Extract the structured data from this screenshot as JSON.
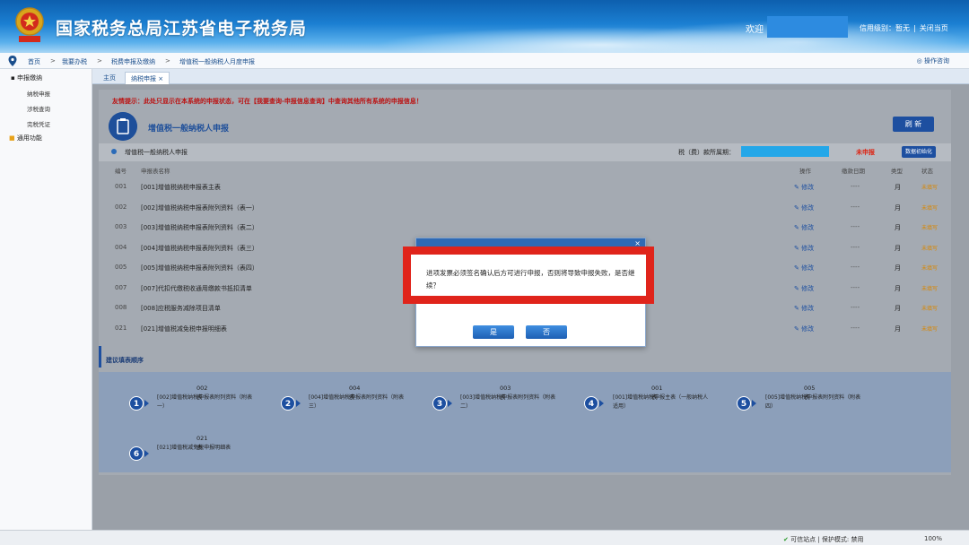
{
  "header": {
    "site_title": "国家税务总局江苏省电子税务局",
    "welcome": "欢迎",
    "credit_level": "信用级别：暂无",
    "close_page": "关闭当页"
  },
  "breadcrumb": {
    "items": [
      "首页",
      "我要办税",
      "税费申报及缴纳",
      "增值税一般纳税人月度申报"
    ],
    "separator": ">",
    "help": "操作咨询"
  },
  "sidebar": {
    "section": "申报缴纳",
    "items": [
      "纳税申报",
      "涉税查询",
      "完税凭证"
    ],
    "common": "通用功能"
  },
  "tabs": [
    "主页",
    "纳税申报"
  ],
  "notice": "友情提示：此处只显示在本系统的申报状态，可在【我要查询-申报信息查询】中查询其他所有系统的申报信息！",
  "form": {
    "title": "增值税一般纳税人申报",
    "refresh": "刷 新",
    "section_label": "增值税一般纳税人申报",
    "period_label": "税（费）款所属期：",
    "unfiled": "未申报",
    "init_button": "数据初始化"
  },
  "table": {
    "headers": [
      "编号",
      "申报表名称",
      "操作",
      "缴款日期",
      "类型",
      "状态"
    ],
    "rows": [
      {
        "code": "001",
        "name": "[001]增值税纳税申报表主表",
        "action": "修改",
        "deadline": "----",
        "type": "月",
        "status": "未填写"
      },
      {
        "code": "002",
        "name": "[002]增值税纳税申报表附列资料（表一）",
        "action": "修改",
        "deadline": "----",
        "type": "月",
        "status": "未填写"
      },
      {
        "code": "003",
        "name": "[003]增值税纳税申报表附列资料（表二）",
        "action": "修改",
        "deadline": "----",
        "type": "月",
        "status": "未填写"
      },
      {
        "code": "004",
        "name": "[004]增值税纳税申报表附列资料（表三）",
        "action": "修改",
        "deadline": "----",
        "type": "月",
        "status": "未填写"
      },
      {
        "code": "005",
        "name": "[005]增值税纳税申报表附列资料（表四）",
        "action": "修改",
        "deadline": "----",
        "type": "月",
        "status": "未填写"
      },
      {
        "code": "007",
        "name": "[007]代扣代缴税收通用缴款书抵扣清单",
        "action": "修改",
        "deadline": "----",
        "type": "月",
        "status": "未填写"
      },
      {
        "code": "008",
        "name": "[008]应税服务减除项目清单",
        "action": "修改",
        "deadline": "----",
        "type": "月",
        "status": "未填写"
      },
      {
        "code": "021",
        "name": "[021]增值税减免税申报明细表",
        "action": "修改",
        "deadline": "----",
        "type": "月",
        "status": "未填写"
      }
    ]
  },
  "suggest": {
    "label": "建议填表顺序",
    "steps": [
      {
        "num": "1",
        "code": "002表",
        "desc": "[002]增值税纳税申报表附列资料（附表一）"
      },
      {
        "num": "2",
        "code": "004表",
        "desc": "[004]增值税纳税申报表附列资料（附表三）"
      },
      {
        "num": "3",
        "code": "003表",
        "desc": "[003]增值税纳税申报表附列资料（附表二）"
      },
      {
        "num": "4",
        "code": "001表",
        "desc": "[001]增值税纳税申报主表（一般纳税人适用）"
      },
      {
        "num": "5",
        "code": "005表",
        "desc": "[005]增值税纳税申报表附列资料（附表四）"
      },
      {
        "num": "6",
        "code": "021表",
        "desc": "[021]增值税减免税申报明细表"
      }
    ]
  },
  "modal": {
    "message": "进项发票必须签名确认后方可进行申报，否则将导致申报失败，是否继续？",
    "yes": "是",
    "no": "否",
    "close": "×"
  },
  "statusbar": {
    "trust": "可信站点 | 保护模式: 禁用",
    "zoom": "100%"
  },
  "colors": {
    "brand_blue": "#1d4fa0",
    "alert_red": "#e0241b",
    "status_orange": "#d88600"
  }
}
